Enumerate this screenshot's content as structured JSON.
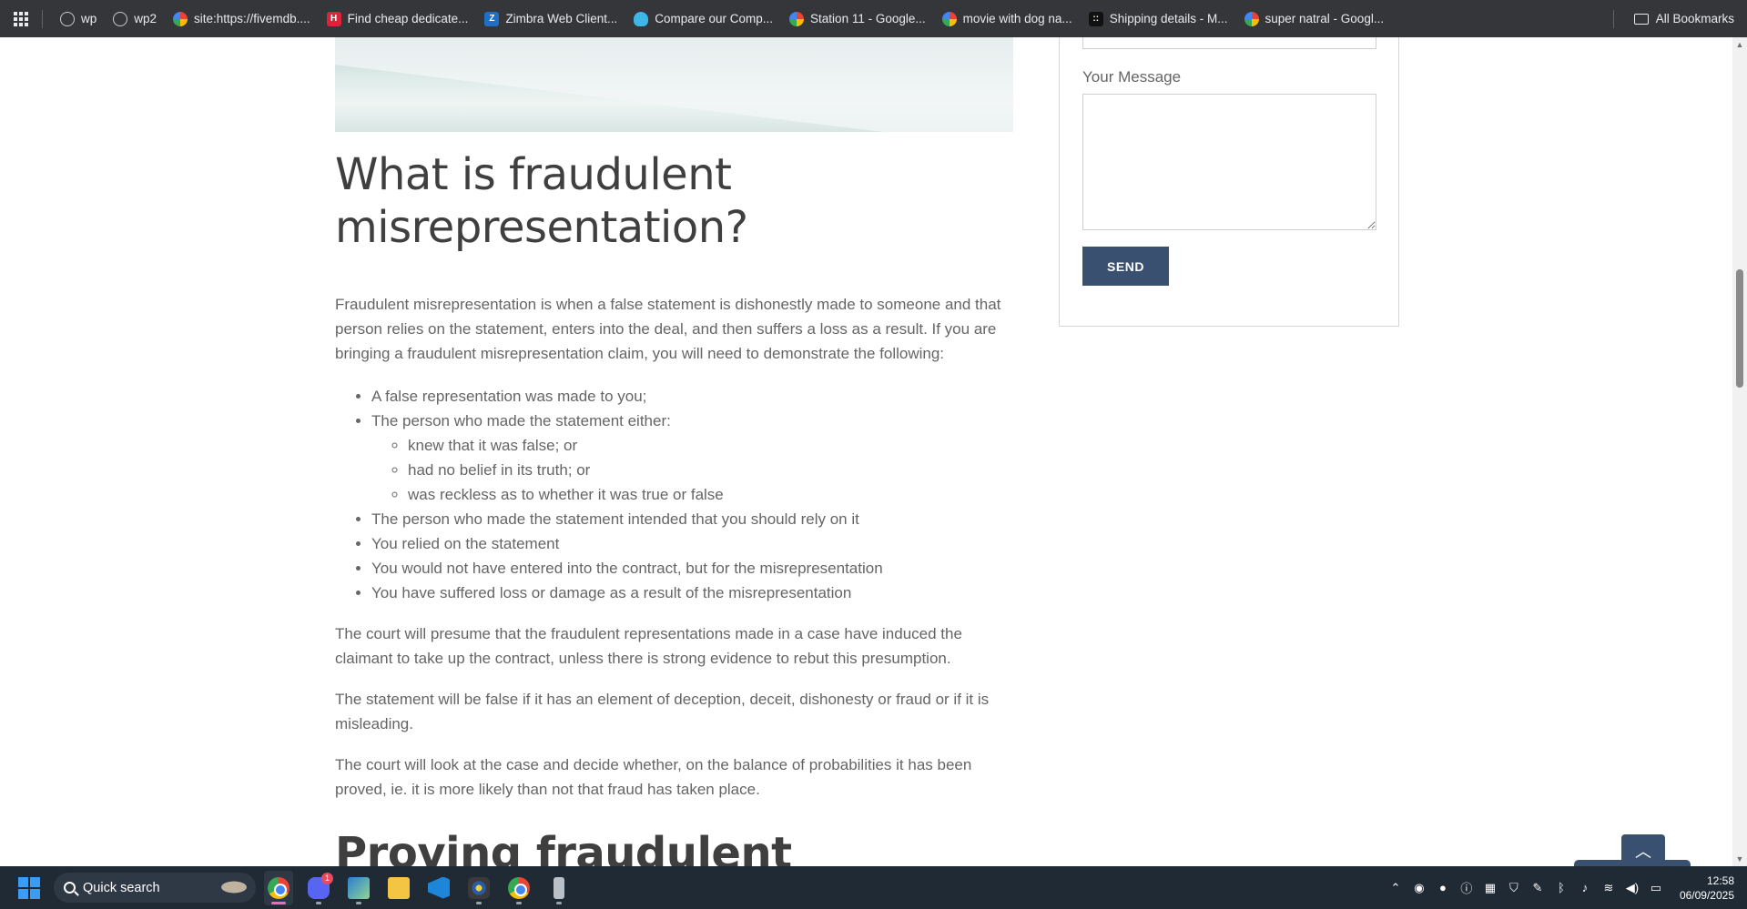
{
  "bookmarks": {
    "items": [
      {
        "label": "wp",
        "icon": "globe-icon"
      },
      {
        "label": "wp2",
        "icon": "globe-icon"
      },
      {
        "label": "site:https://fivemdb....",
        "icon": "google-icon"
      },
      {
        "label": "Find cheap dedicate...",
        "icon": "h-logo-icon",
        "glyph": "H"
      },
      {
        "label": "Zimbra Web Client...",
        "icon": "zimbra-icon",
        "glyph": "Z"
      },
      {
        "label": "Compare our Comp...",
        "icon": "cloud-icon"
      },
      {
        "label": "Station 11 - Google...",
        "icon": "google-icon"
      },
      {
        "label": "movie with dog na...",
        "icon": "google-icon"
      },
      {
        "label": "Shipping details - M...",
        "icon": "dots-icon",
        "glyph": "::"
      },
      {
        "label": "super natral - Googl...",
        "icon": "google-icon"
      }
    ],
    "all_bookmarks": "All Bookmarks"
  },
  "article": {
    "heading": "What is fraudulent misrepresentation?",
    "intro": "Fraudulent misrepresentation is when a false statement is dishonestly made to someone and that person relies on the statement, enters into the deal, and then suffers a loss as a result. If you are bringing a fraudulent misrepresentation claim, you will need to demonstrate the following:",
    "bullet_1": "A false representation was made to you;",
    "bullet_2": "The person who made the statement either:",
    "sub_bullets": [
      "knew that it was false; or",
      "had no belief in its truth; or",
      "was reckless as to whether it was true or false"
    ],
    "bullets_rest": [
      "The person who made the statement intended that you should rely on it",
      "You relied on the statement",
      "You would not have entered into the contract, but for the misrepresentation",
      "You have suffered loss or damage as a result of the misrepresentation"
    ],
    "para_2": "The court will presume that the fraudulent representations made in a case have induced the claimant to take up the contract, unless there is strong evidence to rebut this presumption.",
    "para_3": "The statement will be false if it has an element of deception, deceit, dishonesty or fraud or if it is misleading.",
    "para_4": "The court will look at the case and decide whether, on the balance of probabilities it has been proved, ie. it is more likely than not that fraud has taken place.",
    "heading_2": "Proving fraudulent"
  },
  "form": {
    "message_label": "Your Message",
    "send_label": "SEND"
  },
  "taskbar": {
    "search_label": "Quick search",
    "discord_badge": "1",
    "time": "12:58",
    "date": "06/09/2025"
  },
  "colors": {
    "bookmarks_bg": "#35363a",
    "button_navy": "#3a5070",
    "text_gray": "#656565",
    "taskbar_bg": "#202a35"
  }
}
